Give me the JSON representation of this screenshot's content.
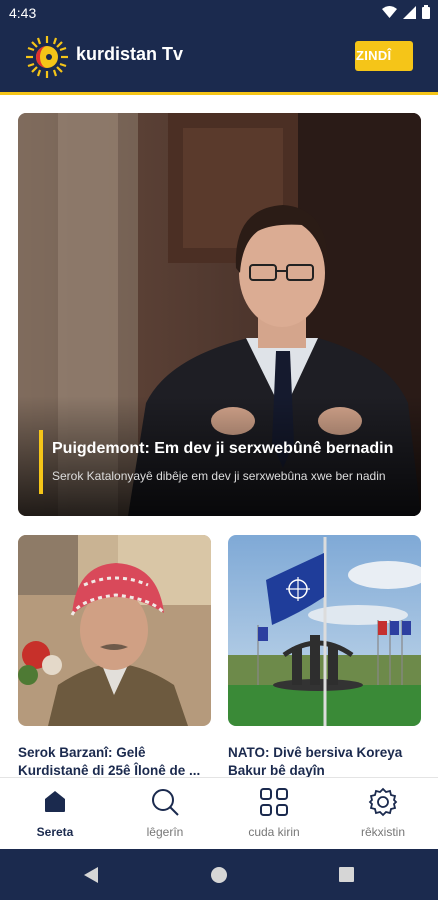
{
  "status_bar": {
    "time": "4:43"
  },
  "app": {
    "title": "kurdistan Tv",
    "live_label": "ZINDÎ"
  },
  "hero": {
    "title": "Puigdemont: Em dev ji serxwebûnê bernadin",
    "subtitle": "Serok Katalonyayê dibêje em dev ji serxwebûna xwe ber nadin"
  },
  "cards": [
    {
      "title_line1": "Serok Barzanî: Gelê",
      "title_line2": "Kurdistanê di 25ê Îlonê de ..."
    },
    {
      "title_line1": "NATO: Divê bersiva Koreya",
      "title_line2": "Bakur bê dayîn"
    }
  ],
  "bottom_nav": [
    {
      "label": "Sereta",
      "icon": "home-icon",
      "active": true
    },
    {
      "label": "lêgerîn",
      "icon": "search-icon",
      "active": false
    },
    {
      "label": "cuda kirin",
      "icon": "grid-icon",
      "active": false
    },
    {
      "label": "rêkxistin",
      "icon": "gear-icon",
      "active": false
    }
  ],
  "colors": {
    "primary": "#1b2a4e",
    "accent": "#f5c518"
  }
}
